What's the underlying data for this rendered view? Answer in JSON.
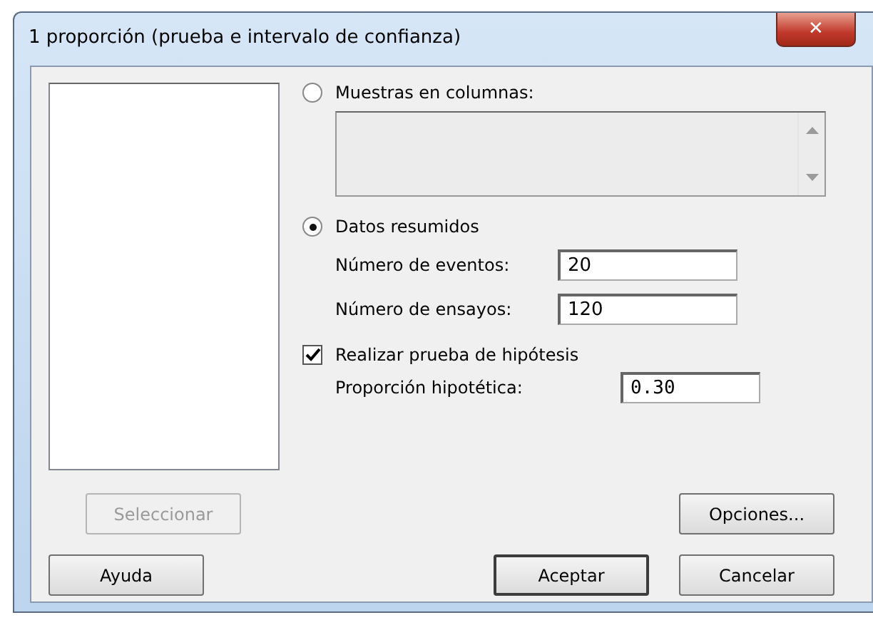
{
  "window": {
    "title": "1 proporción (prueba e intervalo de confianza)",
    "close": "✕"
  },
  "sources": [
    {
      "kind": "radio",
      "label": "Muestras en columnas:",
      "selected": false,
      "field": {
        "disabled": true
      }
    },
    {
      "kind": "radio",
      "label": "Datos resumidos",
      "selected": true,
      "fields": [
        {
          "label": "Número de eventos:",
          "value": "20"
        },
        {
          "label": "Número de ensayos:",
          "value": "120"
        }
      ]
    }
  ],
  "hypothesis_test": {
    "label": "Realizar prueba de hipótesis",
    "checked": true,
    "field": {
      "label": "Proporción hipotética:",
      "value": "0.30"
    }
  },
  "buttons": [
    {
      "label": "Seleccionar",
      "disabled": true,
      "default": false
    },
    {
      "label": "Opciones...",
      "disabled": false,
      "default": false
    },
    {
      "label": "Ayuda",
      "disabled": false,
      "default": false
    },
    {
      "label": "Aceptar",
      "disabled": false,
      "default": true
    },
    {
      "label": "Cancelar",
      "disabled": false,
      "default": false
    }
  ]
}
